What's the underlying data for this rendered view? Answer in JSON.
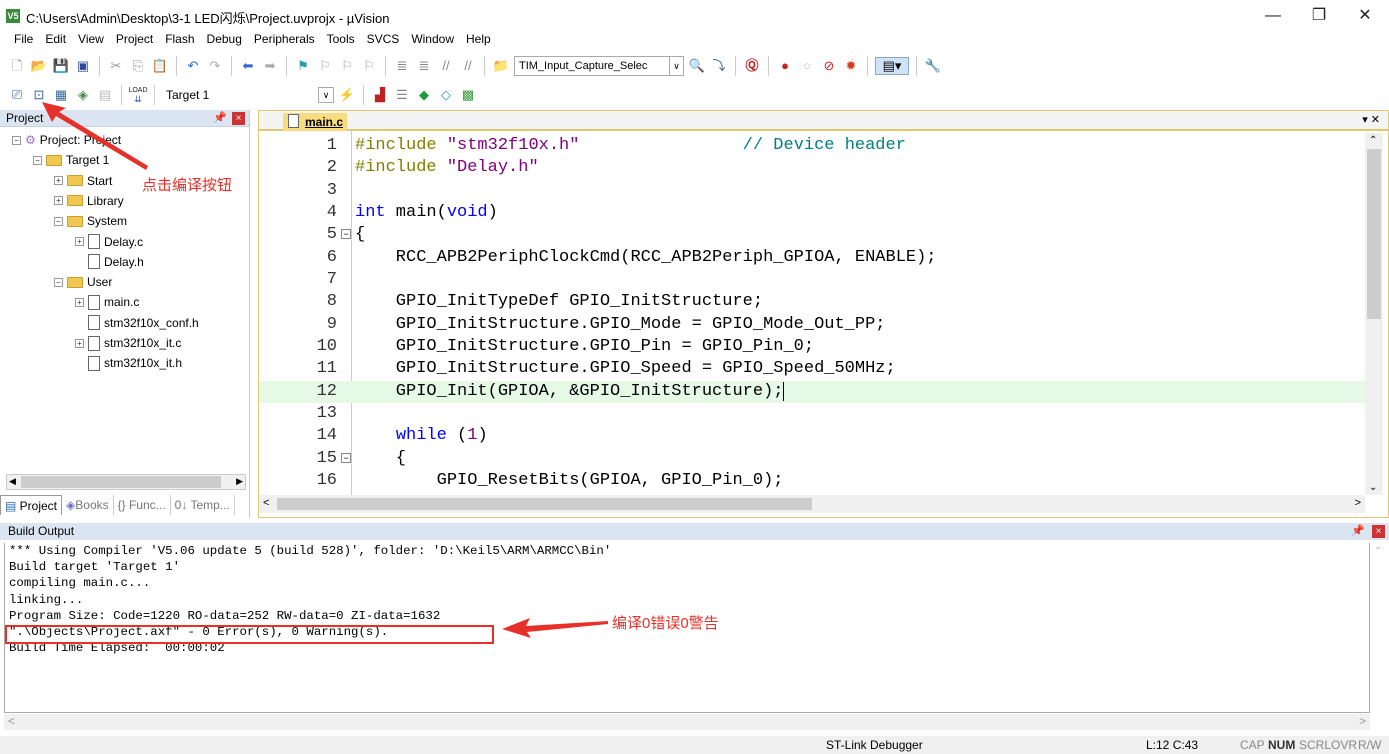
{
  "window": {
    "title": "C:\\Users\\Admin\\Desktop\\3-1 LED闪烁\\Project.uvprojx - µVision",
    "icon_label": "V5"
  },
  "menu": [
    "File",
    "Edit",
    "View",
    "Project",
    "Flash",
    "Debug",
    "Peripherals",
    "Tools",
    "SVCS",
    "Window",
    "Help"
  ],
  "toolbar": {
    "find_combo": "TIM_Input_Capture_Selec",
    "target_combo": "Target 1",
    "load_label": "LOAD"
  },
  "project_panel": {
    "title": "Project",
    "tree": [
      {
        "label": "Project: Project",
        "level": 0,
        "icon": "project-icon",
        "expander": "−"
      },
      {
        "label": "Target 1",
        "level": 1,
        "icon": "target-folder-icon",
        "expander": "−"
      },
      {
        "label": "Start",
        "level": 2,
        "icon": "folder-icon",
        "expander": "+"
      },
      {
        "label": "Library",
        "level": 2,
        "icon": "folder-icon",
        "expander": "+"
      },
      {
        "label": "System",
        "level": 2,
        "icon": "folder-icon",
        "expander": "−"
      },
      {
        "label": "Delay.c",
        "level": 3,
        "icon": "file-icon",
        "expander": "+"
      },
      {
        "label": "Delay.h",
        "level": 3,
        "icon": "file-icon",
        "expander": ""
      },
      {
        "label": "User",
        "level": 2,
        "icon": "folder-icon",
        "expander": "−"
      },
      {
        "label": "main.c",
        "level": 3,
        "icon": "file-icon",
        "expander": "+"
      },
      {
        "label": "stm32f10x_conf.h",
        "level": 3,
        "icon": "file-icon",
        "expander": ""
      },
      {
        "label": "stm32f10x_it.c",
        "level": 3,
        "icon": "file-icon",
        "expander": "+"
      },
      {
        "label": "stm32f10x_it.h",
        "level": 3,
        "icon": "file-icon",
        "expander": ""
      }
    ],
    "tabs": [
      "Project",
      "Books",
      "{} Func...",
      "0↓ Temp..."
    ]
  },
  "editor": {
    "tab": "main.c",
    "highlight_line": 12,
    "lines": [
      {
        "n": "1",
        "fold": "",
        "seg": [
          [
            "#include ",
            "#808000"
          ],
          [
            "\"stm32f10x.h\"",
            "#800080"
          ],
          [
            "                // Device header",
            "#008080"
          ]
        ]
      },
      {
        "n": "2",
        "fold": "",
        "seg": [
          [
            "#include ",
            "#808000"
          ],
          [
            "\"Delay.h\"",
            "#800080"
          ]
        ]
      },
      {
        "n": "3",
        "fold": "",
        "seg": []
      },
      {
        "n": "4",
        "fold": "",
        "seg": [
          [
            "int",
            "#0000ff"
          ],
          [
            " main(",
            "#000"
          ],
          [
            "void",
            "#0000ff"
          ],
          [
            ")",
            "#000"
          ]
        ]
      },
      {
        "n": "5",
        "fold": "−",
        "seg": [
          [
            "{",
            "#000"
          ]
        ]
      },
      {
        "n": "6",
        "fold": "",
        "seg": [
          [
            "    RCC_APB2PeriphClockCmd(RCC_APB2Periph_GPIOA, ENABLE);",
            "#000"
          ]
        ]
      },
      {
        "n": "7",
        "fold": "",
        "seg": []
      },
      {
        "n": "8",
        "fold": "",
        "seg": [
          [
            "    GPIO_InitTypeDef GPIO_InitStructure;",
            "#000"
          ]
        ]
      },
      {
        "n": "9",
        "fold": "",
        "seg": [
          [
            "    GPIO_InitStructure.GPIO_Mode = GPIO_Mode_Out_PP;",
            "#000"
          ]
        ]
      },
      {
        "n": "10",
        "fold": "",
        "seg": [
          [
            "    GPIO_InitStructure.GPIO_Pin = GPIO_Pin_0;",
            "#000"
          ]
        ]
      },
      {
        "n": "11",
        "fold": "",
        "seg": [
          [
            "    GPIO_InitStructure.GPIO_Speed = GPIO_Speed_50MHz;",
            "#000"
          ]
        ]
      },
      {
        "n": "12",
        "fold": "",
        "seg": [
          [
            "    GPIO_Init(GPIOA, &GPIO_InitStructure);",
            "#000"
          ]
        ]
      },
      {
        "n": "13",
        "fold": "",
        "seg": []
      },
      {
        "n": "14",
        "fold": "",
        "seg": [
          [
            "    ",
            "#000"
          ],
          [
            "while",
            "#0000ff"
          ],
          [
            " (",
            "#000"
          ],
          [
            "1",
            "#800080"
          ],
          [
            ")",
            "#000"
          ]
        ]
      },
      {
        "n": "15",
        "fold": "−",
        "seg": [
          [
            "    {",
            "#000"
          ]
        ]
      },
      {
        "n": "16",
        "fold": "",
        "seg": [
          [
            "        GPIO_ResetBits(GPIOA, GPIO_Pin_0);",
            "#000"
          ]
        ]
      }
    ]
  },
  "build_output": {
    "title": "Build Output",
    "lines": [
      "*** Using Compiler 'V5.06 update 5 (build 528)', folder: 'D:\\Keil5\\ARM\\ARMCC\\Bin'",
      "Build target 'Target 1'",
      "compiling main.c...",
      "linking...",
      "Program Size: Code=1220 RO-data=252 RW-data=0 ZI-data=1632",
      "\".\\Objects\\Project.axf\" - 0 Error(s), 0 Warning(s).",
      "Build Time Elapsed:  00:00:02"
    ]
  },
  "annotations": {
    "build_button": "点击编译按钮",
    "result": "编译0错误0警告"
  },
  "status": {
    "debugger": "ST-Link Debugger",
    "position": "L:12 C:43",
    "cap": "CAP",
    "num": "NUM",
    "scrl": "SCRL",
    "ovr": "OVR",
    "rw": "R/W"
  }
}
